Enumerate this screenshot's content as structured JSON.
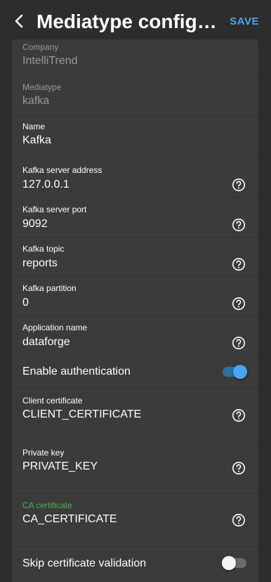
{
  "header": {
    "title": "Mediatype configuration",
    "save_label": "SAVE"
  },
  "colors": {
    "accent": "#4aa3f5",
    "ca_label": "#4caf50",
    "background": "#2d2d2d",
    "card": "#3b3b3b"
  },
  "fields": {
    "company": {
      "label": "Company",
      "value": "IntelliTrend"
    },
    "mediatype": {
      "label": "Mediatype",
      "value": "kafka"
    },
    "name": {
      "label": "Name",
      "value": "Kafka"
    },
    "server_address": {
      "label": "Kafka server address",
      "value": "127.0.0.1"
    },
    "server_port": {
      "label": "Kafka server port",
      "value": "9092"
    },
    "topic": {
      "label": "Kafka topic",
      "value": "reports"
    },
    "partition": {
      "label": "Kafka partition",
      "value": "0"
    },
    "app_name": {
      "label": "Application name",
      "value": "dataforge"
    },
    "enable_auth": {
      "label": "Enable authentication",
      "checked": true
    },
    "client_cert": {
      "label": "Client certificate",
      "value": "CLIENT_CERTIFICATE"
    },
    "private_key": {
      "label": "Private key",
      "value": "PRIVATE_KEY"
    },
    "ca_cert": {
      "label": "CA certificate",
      "value": "CA_CERTIFICATE"
    },
    "skip_validation": {
      "label": "Skip certificate validation",
      "checked": false
    }
  },
  "icons": {
    "back": "chevron-left-icon",
    "help": "help-circle-icon"
  }
}
